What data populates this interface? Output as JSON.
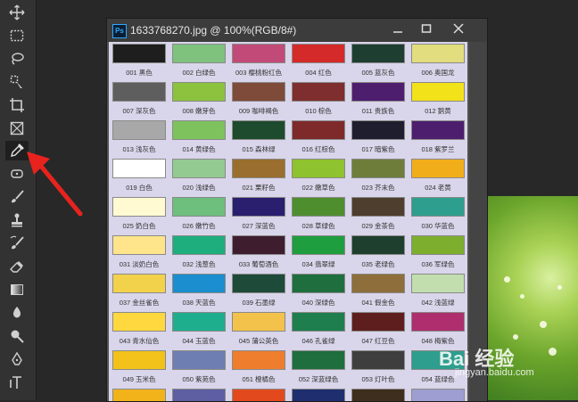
{
  "window": {
    "title": "1633768270.jpg @ 100%(RGB/8#)",
    "app_badge": "Ps"
  },
  "tools": [
    {
      "name": "move-tool-icon"
    },
    {
      "name": "marquee-tool-icon"
    },
    {
      "name": "lasso-tool-icon"
    },
    {
      "name": "quick-select-tool-icon"
    },
    {
      "name": "crop-tool-icon"
    },
    {
      "name": "frame-tool-icon"
    },
    {
      "name": "eyedropper-tool-icon"
    },
    {
      "name": "healing-brush-tool-icon"
    },
    {
      "name": "brush-tool-icon"
    },
    {
      "name": "clone-stamp-tool-icon"
    },
    {
      "name": "history-brush-tool-icon"
    },
    {
      "name": "eraser-tool-icon"
    },
    {
      "name": "gradient-tool-icon"
    },
    {
      "name": "blur-tool-icon"
    },
    {
      "name": "dodge-tool-icon"
    },
    {
      "name": "pen-tool-icon"
    },
    {
      "name": "type-tool-icon"
    }
  ],
  "watermark": {
    "text": "Bai 经验",
    "sub": "jingyan.baidu.com"
  },
  "palette": {
    "rows": [
      [
        {
          "c": "#1e1e1e",
          "label": "001 黑色"
        },
        {
          "c": "#7ec27e",
          "label": "002 白绿色"
        },
        {
          "c": "#c24a78",
          "label": "003 樱桃粉红色"
        },
        {
          "c": "#d42a2a",
          "label": "004 红色"
        },
        {
          "c": "#1e3e32",
          "label": "005 蓝灰色"
        },
        {
          "c": "#e2dd7e",
          "label": "006 奥国龙"
        }
      ],
      [
        {
          "c": "#5e5e5e",
          "label": "007 深灰色"
        },
        {
          "c": "#8cc23e",
          "label": "008 嫩芽色"
        },
        {
          "c": "#7e4a3a",
          "label": "009 咖啡褐色"
        },
        {
          "c": "#7e2e2e",
          "label": "010 棕色"
        },
        {
          "c": "#4e1e6e",
          "label": "011 贵族色"
        },
        {
          "c": "#f2e21a",
          "label": "012 鹅黄"
        }
      ],
      [
        {
          "c": "#a8a8a8",
          "label": "013 浅灰色"
        },
        {
          "c": "#7ec25e",
          "label": "014 黄绿色"
        },
        {
          "c": "#1e4a2e",
          "label": "015 森林绿"
        },
        {
          "c": "#7e2a2a",
          "label": "016 红棕色"
        },
        {
          "c": "#1e1e2e",
          "label": "017 暗紫色"
        },
        {
          "c": "#4e1e6e",
          "label": "018 紫罗兰"
        }
      ],
      [
        {
          "c": "#ffffff",
          "label": "019 白色"
        },
        {
          "c": "#92ca92",
          "label": "020 浅绿色"
        },
        {
          "c": "#9a6e2e",
          "label": "021 栗籽色"
        },
        {
          "c": "#8ec22e",
          "label": "022 嫩草色"
        },
        {
          "c": "#6e7e3a",
          "label": "023 芥末色"
        },
        {
          "c": "#f2ae1a",
          "label": "024 老黄"
        }
      ],
      [
        {
          "c": "#fffad2",
          "label": "025 奶白色"
        },
        {
          "c": "#6ebe7e",
          "label": "026 嫩竹色"
        },
        {
          "c": "#2a1e6e",
          "label": "027 深蓝色"
        },
        {
          "c": "#4e8e2e",
          "label": "028 草绿色"
        },
        {
          "c": "#4e3e2e",
          "label": "029 金茶色"
        },
        {
          "c": "#2e9e8e",
          "label": "030 华蓝色"
        }
      ],
      [
        {
          "c": "#fee48a",
          "label": "031 淡奶白色"
        },
        {
          "c": "#1eae7e",
          "label": "032 浅葱色"
        },
        {
          "c": "#3e1e2e",
          "label": "033 葡萄酒色"
        },
        {
          "c": "#1e9e3e",
          "label": "034 翡翠绿"
        },
        {
          "c": "#1e3e2e",
          "label": "035 老绿色"
        },
        {
          "c": "#7eae2e",
          "label": "036 军绿色"
        }
      ],
      [
        {
          "c": "#f2d24a",
          "label": "037 金丝雀色"
        },
        {
          "c": "#1a8ece",
          "label": "038 天蓝色"
        },
        {
          "c": "#1e4a3a",
          "label": "039 石墨绿"
        },
        {
          "c": "#1e6e3e",
          "label": "040 深绿色"
        },
        {
          "c": "#8e6e3a",
          "label": "041 假金色"
        },
        {
          "c": "#c2deae",
          "label": "042 浅蓝绿"
        }
      ],
      [
        {
          "c": "#fed83e",
          "label": "043 青水仙色"
        },
        {
          "c": "#1eae8e",
          "label": "044 玉蓝色"
        },
        {
          "c": "#f2c24a",
          "label": "045 蒲公英色"
        },
        {
          "c": "#1e7e4e",
          "label": "046 孔雀绿"
        },
        {
          "c": "#5e1e1e",
          "label": "047 红豆色"
        },
        {
          "c": "#ae2e6e",
          "label": "048 梅紫色"
        }
      ],
      [
        {
          "c": "#f2c21a",
          "label": "049 玉米色"
        },
        {
          "c": "#6e7eb2",
          "label": "050 紫苑色"
        },
        {
          "c": "#ee7e2e",
          "label": "051 橙橘色"
        },
        {
          "c": "#1e6e3e",
          "label": "052 深蓝绿色"
        },
        {
          "c": "#3e3e3e",
          "label": "053 灯叶色"
        },
        {
          "c": "#2e9e8e",
          "label": "054 蓝绿色"
        }
      ],
      [
        {
          "c": "#f2b21a",
          "label": ""
        },
        {
          "c": "#5e5ea2",
          "label": ""
        },
        {
          "c": "#e24a1e",
          "label": ""
        },
        {
          "c": "#1e2e6e",
          "label": ""
        },
        {
          "c": "#3e2e1e",
          "label": ""
        },
        {
          "c": "#9e9ed2",
          "label": ""
        }
      ]
    ]
  }
}
